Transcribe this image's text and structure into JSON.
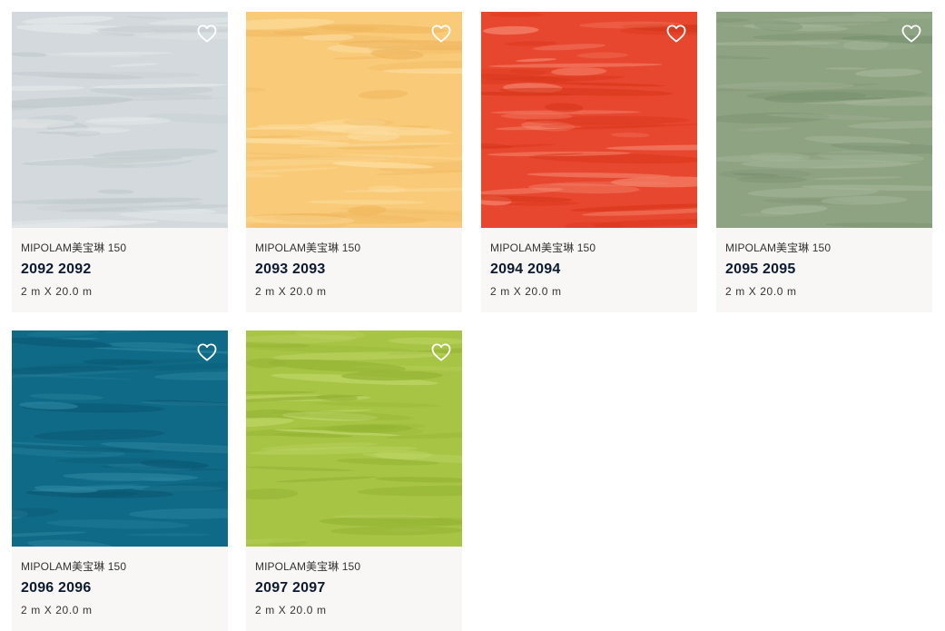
{
  "products": [
    {
      "brand": "MIPOLAM美宝琳 150",
      "code": "2092 2092",
      "size": "2 m X 20.0 m",
      "color": "#d3d9dc",
      "streak_light": "#e6eaec",
      "streak_dark": "#c2c9cd",
      "favorite_icon": "heart-outline-icon"
    },
    {
      "brand": "MIPOLAM美宝琳 150",
      "code": "2093 2093",
      "size": "2 m X 20.0 m",
      "color": "#f9ca78",
      "streak_light": "#fde0a4",
      "streak_dark": "#efb65c",
      "favorite_icon": "heart-outline-icon"
    },
    {
      "brand": "MIPOLAM美宝琳 150",
      "code": "2094 2094",
      "size": "2 m X 20.0 m",
      "color": "#e8472f",
      "streak_light": "#f58a72",
      "streak_dark": "#d73519",
      "favorite_icon": "heart-outline-icon"
    },
    {
      "brand": "MIPOLAM美宝琳 150",
      "code": "2095 2095",
      "size": "2 m X 20.0 m",
      "color": "#8ea382",
      "streak_light": "#a5b79a",
      "streak_dark": "#7a9170",
      "favorite_icon": "heart-outline-icon"
    },
    {
      "brand": "MIPOLAM美宝琳 150",
      "code": "2096 2096",
      "size": "2 m X 20.0 m",
      "color": "#0f6a87",
      "streak_light": "#2a84a0",
      "streak_dark": "#0a5872",
      "favorite_icon": "heart-outline-icon"
    },
    {
      "brand": "MIPOLAM美宝琳 150",
      "code": "2097 2097",
      "size": "2 m X 20.0 m",
      "color": "#a8c444",
      "streak_light": "#c1d86c",
      "streak_dark": "#93b233",
      "favorite_icon": "heart-outline-icon"
    }
  ]
}
